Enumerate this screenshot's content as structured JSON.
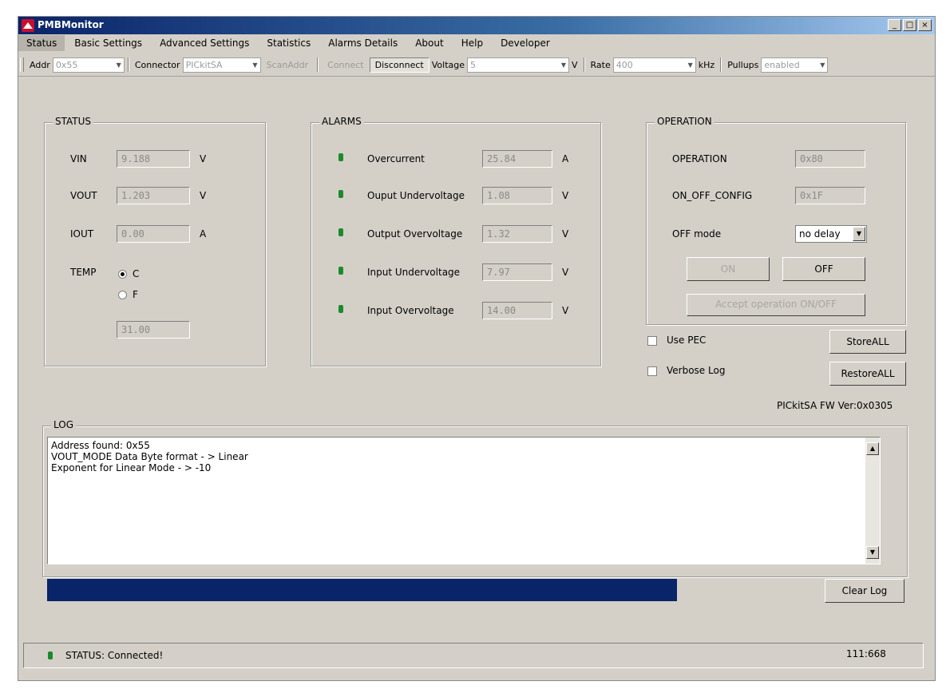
{
  "window": {
    "title": "PMBMonitor",
    "controls": [
      "_",
      "□",
      "×"
    ]
  },
  "menu": [
    "Status",
    "Basic Settings",
    "Advanced Settings",
    "Statistics",
    "Alarms Details",
    "About",
    "Help",
    "Developer"
  ],
  "toolbar": {
    "addr_label": "Addr",
    "addr_value": "0x55",
    "connector_label": "Connector",
    "connector_value": "PICkitSA",
    "scan_label": "ScanAddr",
    "connect_label": "Connect",
    "disconnect_label": "Disconnect",
    "voltage_label": "Voltage",
    "voltage_value": "5",
    "voltage_unit": "V",
    "rate_label": "Rate",
    "rate_value": "400",
    "rate_unit": "kHz",
    "pullups_label": "Pullups",
    "pullups_value": "enabled"
  },
  "status": {
    "title": "STATUS",
    "vin_label": "VIN",
    "vin_value": "9.188",
    "vin_unit": "V",
    "vout_label": "VOUT",
    "vout_value": "1.203",
    "vout_unit": "V",
    "iout_label": "IOUT",
    "iout_value": "0.00",
    "iout_unit": "A",
    "temp_label": "TEMP",
    "temp_c": "C",
    "temp_f": "F",
    "temp_value": "31.00"
  },
  "alarms": {
    "title": "ALARMS",
    "items": [
      {
        "label": "Overcurrent",
        "value": "25.84",
        "unit": "A"
      },
      {
        "label": "Ouput Undervoltage",
        "value": "1.08",
        "unit": "V"
      },
      {
        "label": "Output Overvoltage",
        "value": "1.32",
        "unit": "V"
      },
      {
        "label": "Input Undervoltage",
        "value": "7.97",
        "unit": "V"
      },
      {
        "label": "Input Overvoltage",
        "value": "14.00",
        "unit": "V"
      }
    ],
    "led_color": "#1c8a2c"
  },
  "operation": {
    "title": "OPERATION",
    "operation_label": "OPERATION",
    "operation_value": "0x80",
    "onoff_label": "ON_OFF_CONFIG",
    "onoff_value": "0x1F",
    "offmode_label": "OFF mode",
    "offmode_value": "no delay",
    "on_label": "ON",
    "off_label": "OFF",
    "accept_label": "Accept operation ON/OFF"
  },
  "options": {
    "use_pec": "Use PEC",
    "verbose_log": "Verbose Log",
    "store_all": "StoreALL",
    "restore_all": "RestoreALL",
    "fw_version": "PICkitSA FW Ver:0x0305"
  },
  "log": {
    "title": "LOG",
    "lines": [
      "Address found: 0x55",
      "VOUT_MODE Data Byte format - > Linear",
      "Exponent for Linear Mode - > -10"
    ],
    "clear_label": "Clear Log"
  },
  "progress": {
    "fraction": 0.76,
    "color": "#0a246a"
  },
  "statusbar": {
    "text": "STATUS: Connected!",
    "right": "111:668"
  }
}
